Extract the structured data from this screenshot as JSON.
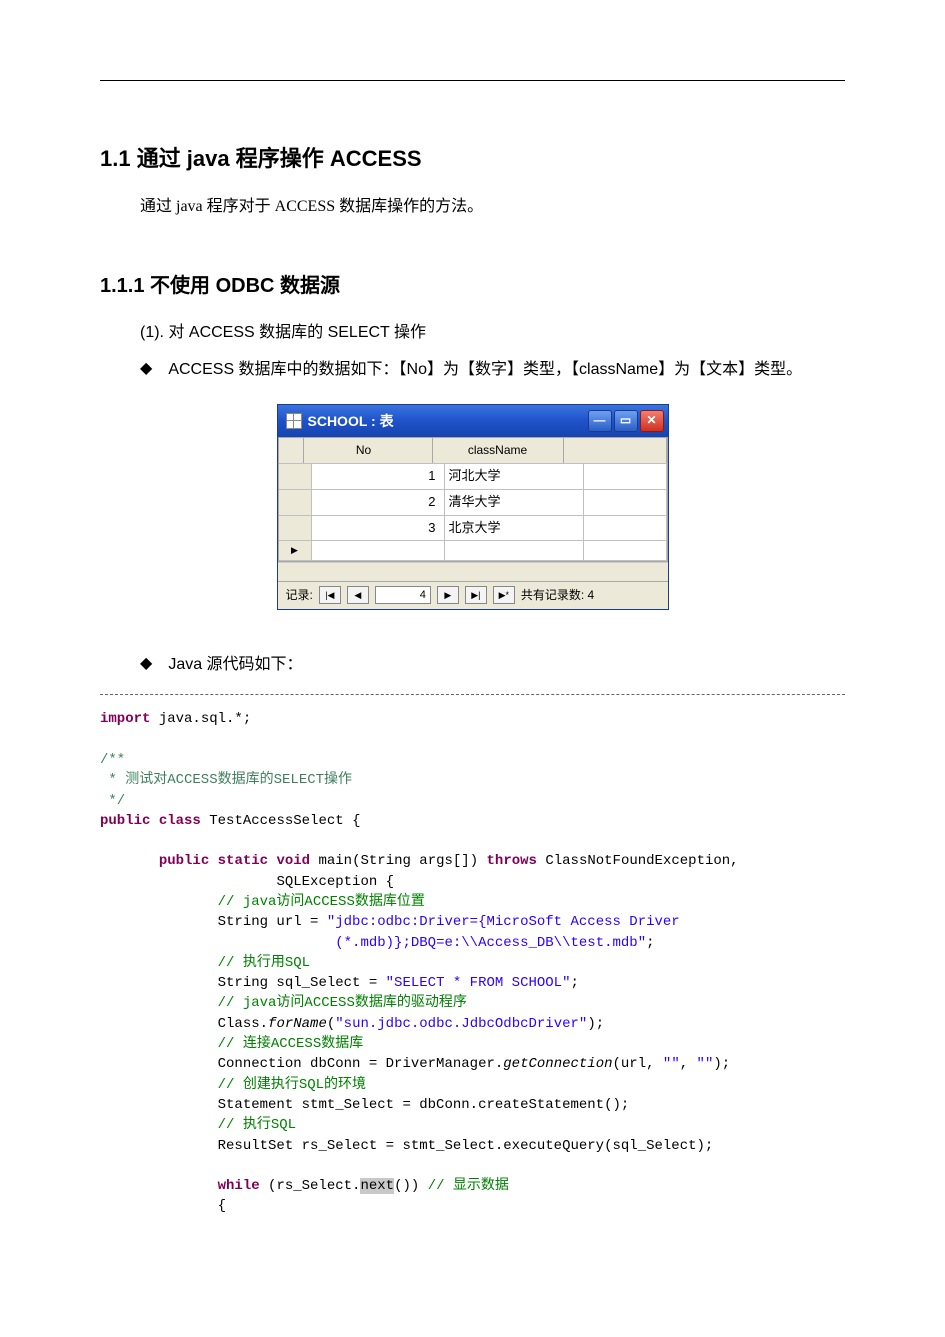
{
  "headings": {
    "h1_1": "1.1  通过 java 程序操作 ACCESS",
    "h1_1_intro": "通过 java 程序对于 ACCESS 数据库操作的方法。",
    "h1_1_1": "1.1.1  不使用 ODBC 数据源",
    "item1": "(1). 对 ACCESS 数据库的 SELECT 操作",
    "bullet_a": "ACCESS 数据库中的数据如下：【No】为【数字】类型，【className】为【文本】类型。",
    "bullet_b": "Java 源代码如下："
  },
  "access_window": {
    "title": "SCHOOL : 表",
    "columns": [
      "No",
      "className"
    ],
    "rows": [
      {
        "no": "1",
        "className": "河北大学"
      },
      {
        "no": "2",
        "className": "清华大学"
      },
      {
        "no": "3",
        "className": "北京大学"
      }
    ],
    "nav": {
      "label": "记录:",
      "current": "4",
      "total_label": "共有记录数: 4"
    }
  },
  "code": {
    "l01_kw": "import",
    "l01_rest": " java.sql.*;",
    "l_doc1": "/**",
    "l_doc2": " * 测试对ACCESS数据库的SELECT操作",
    "l_doc3": " */",
    "l_pc1a": "public",
    "l_pc1b": "class",
    "l_pc1c": " TestAccessSelect {",
    "l_m1a": "public",
    "l_m1b": "static",
    "l_m1c": "void",
    "l_m1d": " main(String args[]) ",
    "l_m1e": "throws",
    "l_m1f": " ClassNotFoundException,",
    "l_m2": "SQLException {",
    "l_c1": "// java访问ACCESS数据库位置",
    "l_s_url_a": "String url = ",
    "l_s_url_b": "\"jdbc:odbc:Driver={MicroSoft Access Driver",
    "l_s_url_c": "(*.mdb)};DBQ=e:\\\\Access_DB\\\\test.mdb\"",
    "l_semi": ";",
    "l_c2": "// 执行用SQL",
    "l_s_sql_a": "String sql_Select = ",
    "l_s_sql_b": "\"SELECT * FROM SCHOOL\"",
    "l_c3": "// java访问ACCESS数据库的驱动程序",
    "l_fn_a": "Class.",
    "l_fn_b": "forName",
    "l_fn_c": "(",
    "l_fn_d": "\"sun.jdbc.odbc.JdbcOdbcDriver\"",
    "l_fn_e": ");",
    "l_c4": "// 连接ACCESS数据库",
    "l_conn_a": "Connection dbConn = DriverManager.",
    "l_conn_b": "getConnection",
    "l_conn_c": "(url, ",
    "l_conn_d": "\"\"",
    "l_conn_e": ", ",
    "l_conn_f": "\"\"",
    "l_conn_g": ");",
    "l_c5": "// 创建执行SQL的环境",
    "l_stmt": "Statement stmt_Select = dbConn.createStatement();",
    "l_c6": "// 执行SQL",
    "l_rs": "ResultSet rs_Select = stmt_Select.executeQuery(sql_Select);",
    "l_wh_a": "while",
    "l_wh_b": " (rs_Select.",
    "l_wh_c": "next",
    "l_wh_d": "()) ",
    "l_wh_e": "// 显示数据",
    "l_brace": "{"
  }
}
